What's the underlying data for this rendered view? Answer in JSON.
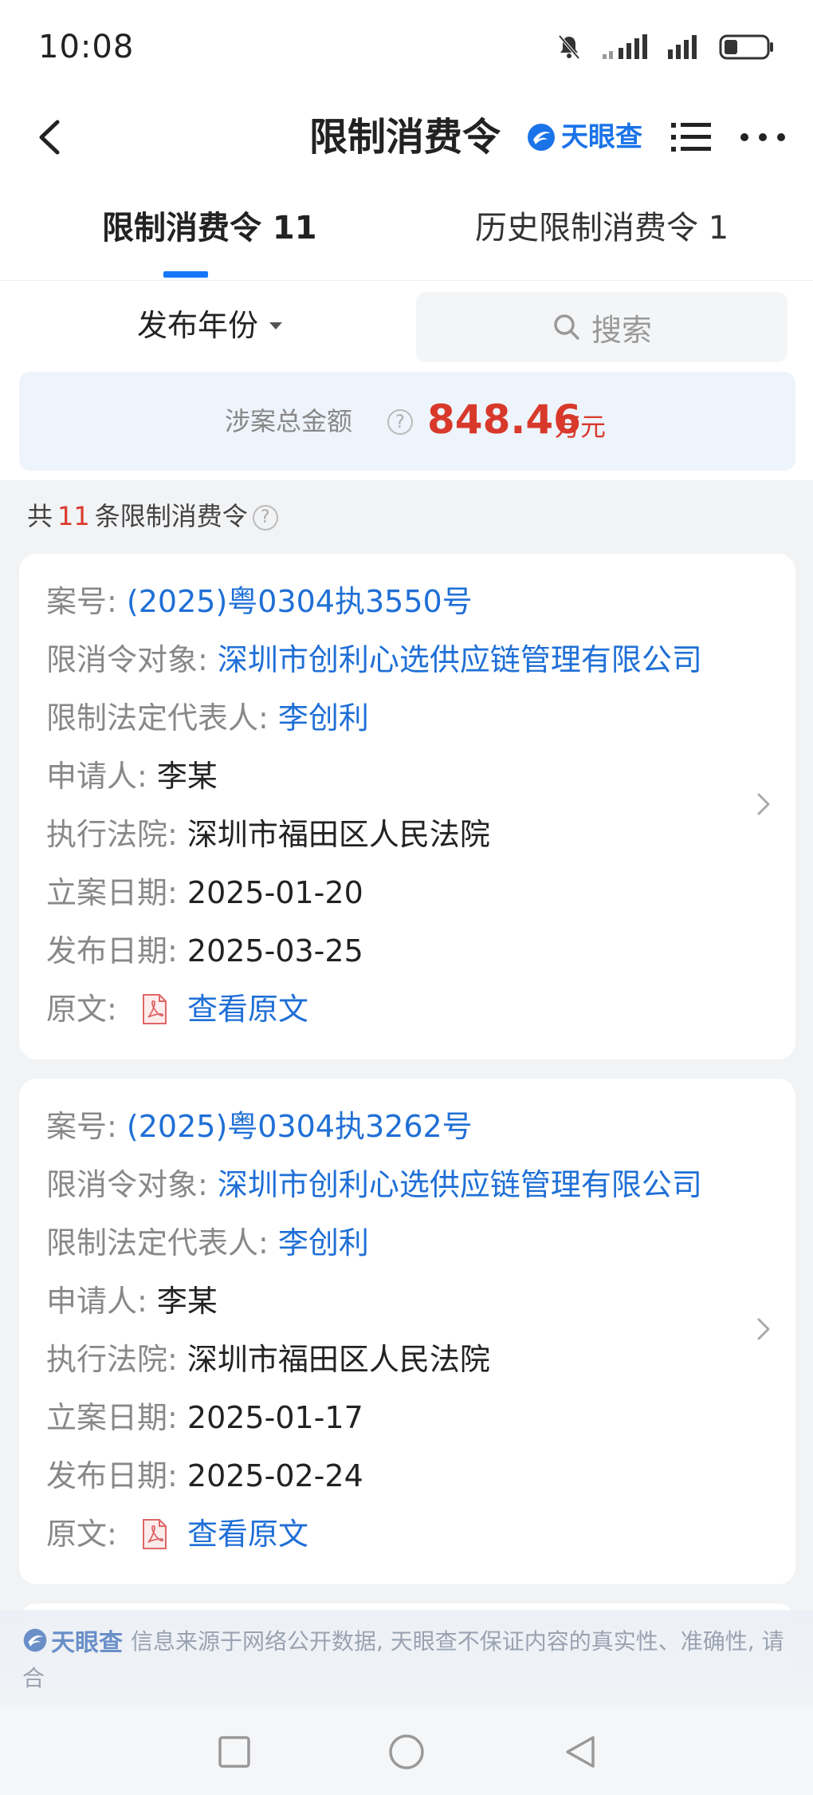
{
  "status_bar": {
    "time": "10:08"
  },
  "header": {
    "title": "限制消费令",
    "brand": "天眼查"
  },
  "tabs": [
    {
      "label": "限制消费令 11",
      "active": true
    },
    {
      "label": "历史限制消费令 1",
      "active": false
    }
  ],
  "filter": {
    "year_label": "发布年份",
    "search_placeholder": "搜索"
  },
  "total": {
    "label": "涉案总金额",
    "amount": "848.46",
    "unit": "万元"
  },
  "count": {
    "prefix": "共",
    "number": "11",
    "suffix": "条限制消费令"
  },
  "cards": [
    {
      "case_no_label": "案号:",
      "case_no": "(2025)粤0304执3550号",
      "target_label": "限消令对象:",
      "target": "深圳市创利心选供应链管理有限公司",
      "rep_label": "限制法定代表人:",
      "rep": "李创利",
      "applicant_label": "申请人:",
      "applicant": "李某",
      "court_label": "执行法院:",
      "court": "深圳市福田区人民法院",
      "filed_label": "立案日期:",
      "filed": "2025-01-20",
      "published_label": "发布日期:",
      "published": "2025-03-25",
      "doc_label": "原文:",
      "doc_link": "查看原文"
    },
    {
      "case_no_label": "案号:",
      "case_no": "(2025)粤0304执3262号",
      "target_label": "限消令对象:",
      "target": "深圳市创利心选供应链管理有限公司",
      "rep_label": "限制法定代表人:",
      "rep": "李创利",
      "applicant_label": "申请人:",
      "applicant": "李某",
      "court_label": "执行法院:",
      "court": "深圳市福田区人民法院",
      "filed_label": "立案日期:",
      "filed": "2025-01-17",
      "published_label": "发布日期:",
      "published": "2025-02-24",
      "doc_label": "原文:",
      "doc_link": "查看原文"
    }
  ],
  "disclaimer": {
    "brand": "天眼查",
    "text": "信息来源于网络公开数据, 天眼查不保证内容的真实性、准确性, 请",
    "text2": "合"
  },
  "colors": {
    "accent": "#1677ff",
    "link": "#1f6fd6",
    "amount": "#d8392b"
  }
}
